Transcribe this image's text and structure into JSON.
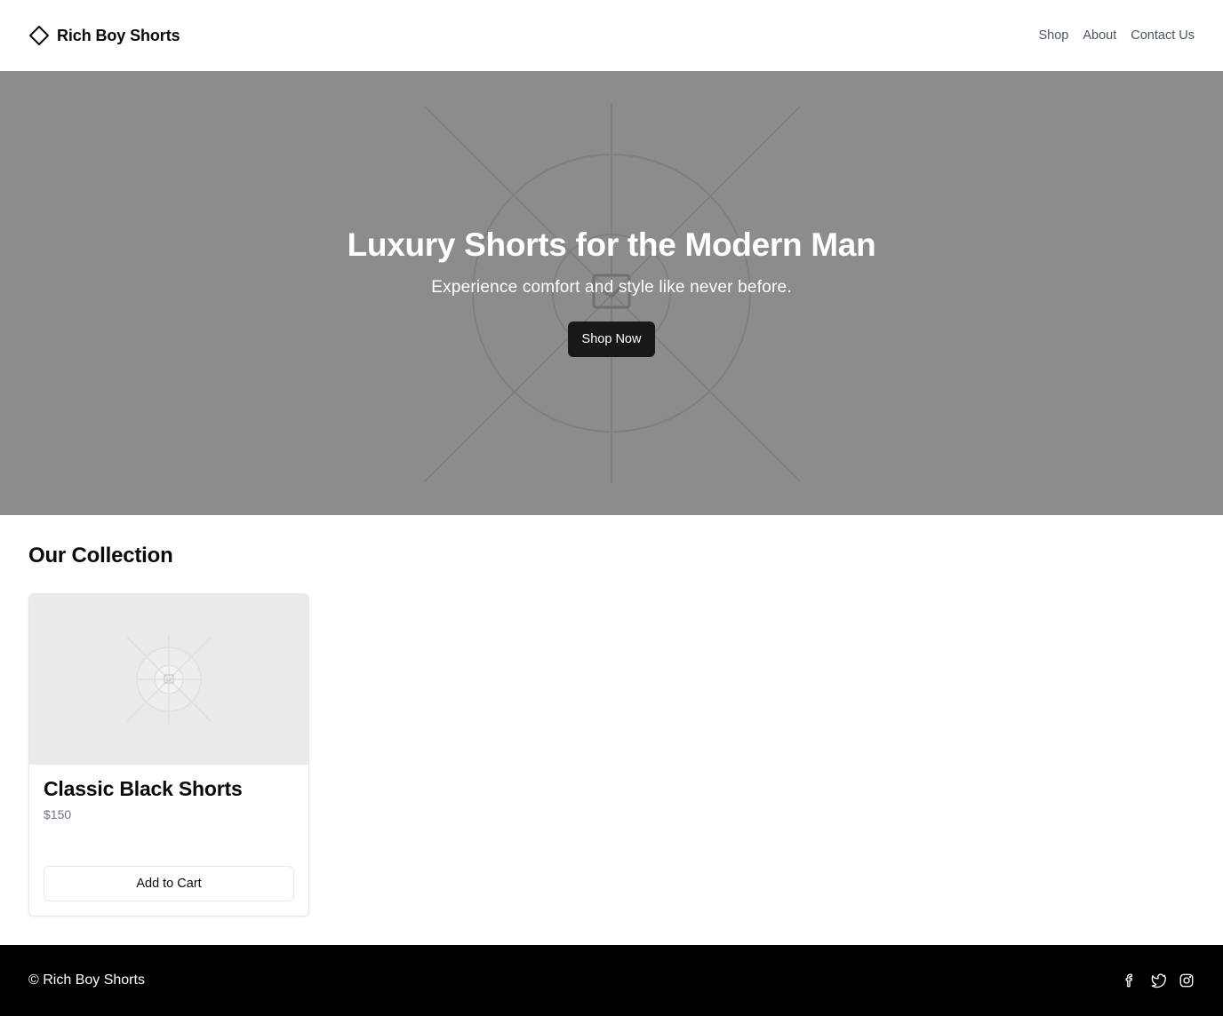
{
  "brand": {
    "name": "Rich Boy Shorts",
    "icon": "diamond-icon"
  },
  "nav": {
    "items": [
      "Shop",
      "About",
      "Contact Us"
    ]
  },
  "hero": {
    "title": "Luxury Shorts for the Modern Man",
    "subtitle": "Experience comfort and style like never before.",
    "cta": "Shop Now",
    "image_icon": "image-placeholder-icon"
  },
  "collection": {
    "title": "Our Collection",
    "products": [
      {
        "name": "Classic Black Shorts",
        "price": "$150",
        "action": "Add to Cart",
        "image_icon": "image-placeholder-icon"
      }
    ]
  },
  "footer": {
    "copyright": "© Rich Boy Shorts",
    "social_icons": [
      "facebook-icon",
      "twitter-icon",
      "instagram-icon"
    ]
  },
  "colors": {
    "hero_background": "#8c8c8c",
    "primary_button": "#18181b",
    "footer_background": "#000000",
    "card_image_background": "#eaeaea"
  }
}
